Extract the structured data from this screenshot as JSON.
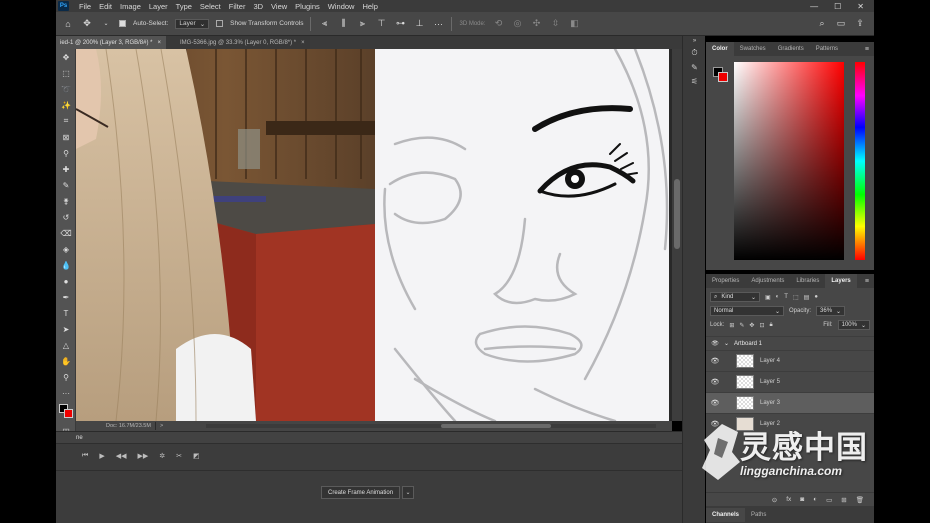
{
  "app": {
    "logo": "Ps"
  },
  "menu": [
    "File",
    "Edit",
    "Image",
    "Layer",
    "Type",
    "Select",
    "Filter",
    "3D",
    "View",
    "Plugins",
    "Window",
    "Help"
  ],
  "window_controls": [
    "—",
    "☐",
    "✕"
  ],
  "options_bar": {
    "auto_select_label": "Auto-Select:",
    "auto_select_target": "Layer",
    "show_transform_label": "Show Transform Controls",
    "mode_3d_label": "3D Mode:"
  },
  "tabs": [
    {
      "title": "ied-1 @ 200% (Layer 3, RGB/8#) *",
      "close": "×"
    },
    {
      "title": "IMG-5366.jpg @ 33.3% (Layer 0, RGB/8*) *",
      "close": "×"
    }
  ],
  "status": {
    "doc": "Doc: 16.7M/23.5M",
    "arrow": ">"
  },
  "timeline": {
    "tab_label": "ne",
    "create_button": "Create Frame Animation",
    "dropdown_arrow": "⌄"
  },
  "color_panel": {
    "tabs": [
      "Color",
      "Swatches",
      "Gradients",
      "Patterns"
    ],
    "foreground": "#000000",
    "background": "#ee0000"
  },
  "layers_panel": {
    "tabs": [
      "Properties",
      "Adjustments",
      "Libraries",
      "Layers"
    ],
    "filter_kind": "Kind",
    "blend_mode": "Normal",
    "opacity_label": "Opacity:",
    "opacity_value": "36%",
    "lock_label": "Lock:",
    "fill_label": "Fill:",
    "fill_value": "100%",
    "artboard": "Artboard 1",
    "layers": [
      {
        "name": "Layer 4",
        "selected": false
      },
      {
        "name": "Layer 5",
        "selected": false
      },
      {
        "name": "Layer 3",
        "selected": true
      },
      {
        "name": "Layer 2",
        "selected": false
      }
    ]
  },
  "bottom_panel": {
    "tabs": [
      "Channels",
      "Paths"
    ]
  },
  "watermark": {
    "chinese": "灵感中国",
    "latin": "lingganchina.com"
  }
}
